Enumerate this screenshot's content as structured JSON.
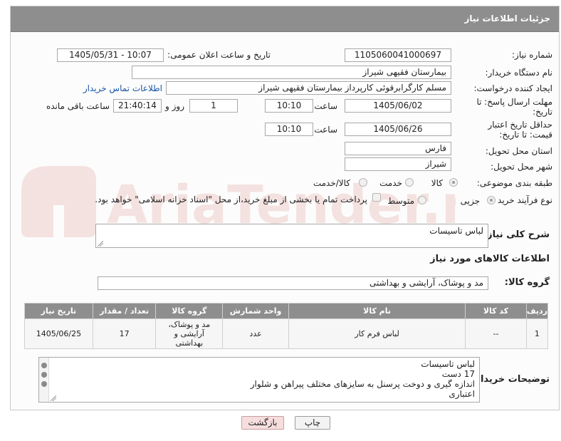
{
  "header": {
    "title": "جزئیات اطلاعات نیاز"
  },
  "fields": {
    "need_number_label": "شماره نیاز:",
    "need_number": "1105060041000697",
    "announce_label": "تاریخ و ساعت اعلان عمومی:",
    "announce_value": "1405/05/31 - 10:07",
    "buyer_org_label": "نام دستگاه خریدار:",
    "buyer_org": "بیمارستان فقیهی شیراز",
    "requester_label": "ایجاد کننده درخواست:",
    "requester": "مسلم کارگرابرقوئی کارپرداز  بیمارستان فقیهی شیراز",
    "contact_link": "اطلاعات تماس خریدار",
    "deadline_label": "مهلت ارسال پاسخ: تا تاریخ:",
    "deadline_date": "1405/06/02",
    "time_label": "ساعت",
    "deadline_time": "10:10",
    "days_value": "1",
    "days_label": "روز و",
    "remaining_time": "21:40:14",
    "remaining_label": "ساعت باقی مانده",
    "min_validity_label": "حداقل تاریخ اعتبار قیمت: تا تاریخ:",
    "validity_date": "1405/06/26",
    "validity_time": "10:10",
    "province_label": "استان محل تحویل:",
    "province": "فارس",
    "city_label": "شهر محل تحویل:",
    "city": "شیراز",
    "category_label": "طبقه بندی موضوعی:",
    "category_options": [
      "کالا",
      "خدمت",
      "کالا/خدمت"
    ],
    "process_label": "نوع فرآیند خرید :",
    "process_options": [
      "جزیی",
      "متوسط"
    ],
    "payment_note": "پرداخت تمام یا بخشی از مبلغ خرید،از محل \"اسناد خزانه اسلامی\" خواهد بود."
  },
  "description": {
    "label": "شرح کلی نیاز:",
    "value": "لباس تاسیسات"
  },
  "goods": {
    "section_title": "اطلاعات کالاهای مورد نیاز",
    "group_label": "گروه کالا:",
    "group_value": "مد و پوشاک، آرایشی و بهداشتی",
    "columns": [
      "ردیف",
      "کد کالا",
      "نام کالا",
      "واحد شمارش",
      "گروه کالا",
      "تعداد / مقدار",
      "تاریخ نیاز"
    ],
    "rows": [
      {
        "row": "1",
        "code": "--",
        "name": "لباس فرم کار",
        "unit": "عدد",
        "group": "مد و پوشاک، آرایشی و بهداشتی",
        "qty": "17",
        "date": "1405/06/25"
      }
    ]
  },
  "notes": {
    "label": "توضیحات خریدار:",
    "lines": [
      "لباس تاسیسات",
      "17 دست",
      "اندازه گیری و دوخت پرسنل به سایزهای مختلف پیراهن و شلوار",
      "اعتباری"
    ]
  },
  "buttons": {
    "print": "چاپ",
    "back": "بازگشت"
  },
  "watermark": {
    "text": "AriaTender.net"
  }
}
